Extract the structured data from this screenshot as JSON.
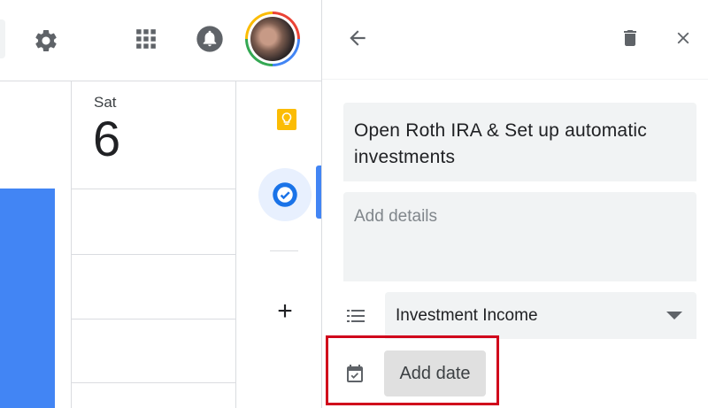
{
  "topbar": {
    "icons": [
      "gear-icon",
      "apps-grid-icon",
      "notifications-bell-icon",
      "account-avatar"
    ]
  },
  "calendar": {
    "day_name": "Sat",
    "day_number": "6",
    "event_color": "#4285f4"
  },
  "side_rail": {
    "items": [
      "keep-icon",
      "tasks-icon",
      "add-icon"
    ],
    "add_label": "+"
  },
  "task_panel": {
    "title": "Open Roth IRA & Set up automatic investments",
    "details_placeholder": "Add details",
    "list_selected": "Investment Income",
    "add_date_label": "Add date",
    "highlight_color": "#d0021b"
  }
}
